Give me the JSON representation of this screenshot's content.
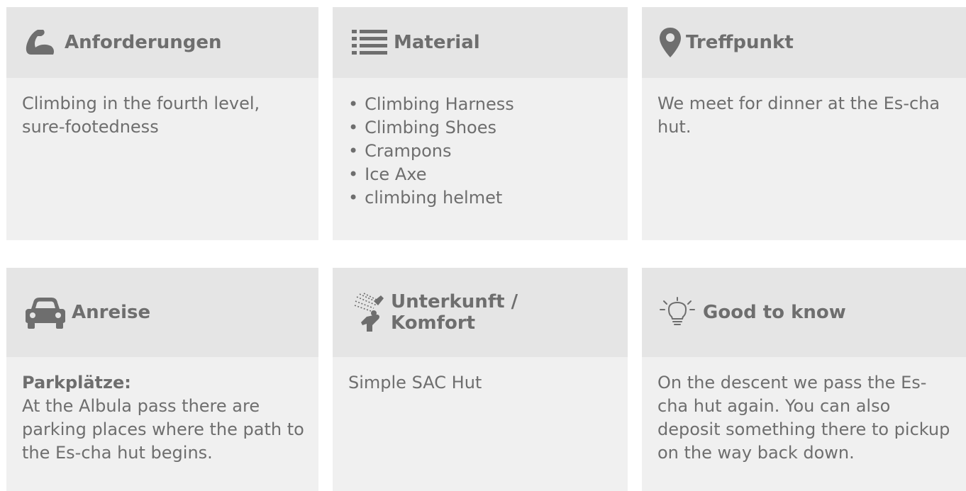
{
  "cards": {
    "anforderungen": {
      "icon": "flexed-bicep-icon",
      "title": "Anforderungen",
      "text": "Climbing in the fourth level, sure-footedness"
    },
    "material": {
      "icon": "list-icon",
      "title": "Material",
      "items": [
        "Climbing Harness",
        "Climbing Shoes",
        "Crampons",
        "Ice Axe",
        "climbing helmet"
      ]
    },
    "treffpunkt": {
      "icon": "map-pin-icon",
      "title": "Treffpunkt",
      "text": "We meet for dinner at the Es-cha hut."
    },
    "anreise": {
      "icon": "car-icon",
      "title": "Anreise",
      "label": "Parkplätze:",
      "text": "At the Albula pass there are parking places where the path to the Es-cha hut begins."
    },
    "unterkunft": {
      "icon": "shower-icon",
      "title": "Unterkunft / Komfort",
      "text": "Simple SAC Hut"
    },
    "good_to_know": {
      "icon": "lightbulb-icon",
      "title": "Good to know",
      "text": "On the descent we pass the Es-cha hut again. You can also deposit something there to pickup on the way back down."
    }
  },
  "colors": {
    "header_bg": "#e5e5e5",
    "body_bg": "#f0f0f0",
    "text": "#6e6e6e"
  }
}
